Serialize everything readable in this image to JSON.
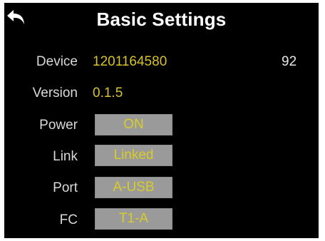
{
  "header": {
    "title": "Basic Settings",
    "back_icon": "back-arrow-icon"
  },
  "rows": {
    "device": {
      "label": "Device",
      "value": "1201164580",
      "extra": "92"
    },
    "version": {
      "label": "Version",
      "value": "0.1.5"
    },
    "power": {
      "label": "Power",
      "value": "ON"
    },
    "link": {
      "label": "Link",
      "value": "Linked"
    },
    "port": {
      "label": "Port",
      "value": "A-USB"
    },
    "fc": {
      "label": "FC",
      "value": "T1-A"
    }
  },
  "colors": {
    "background": "#000000",
    "title": "#ffffff",
    "value": "#d7c22c",
    "button": "#9a9a9a"
  }
}
